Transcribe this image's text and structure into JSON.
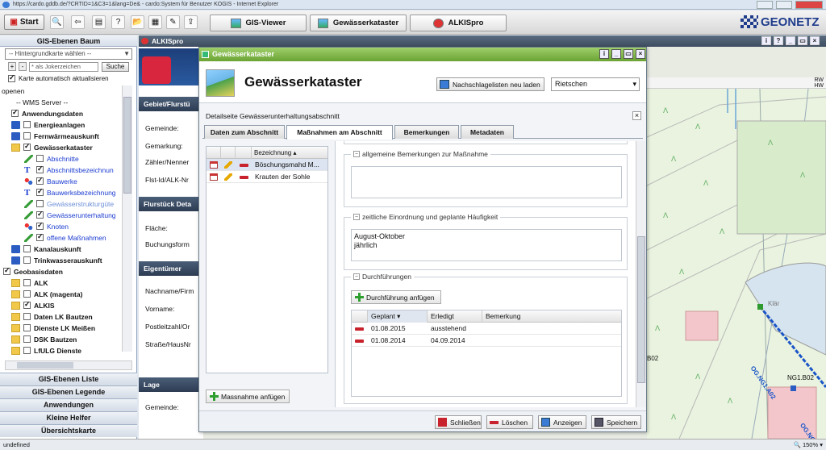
{
  "browser": {
    "url": "https://cardo.gddb.de/?CRTID=1&C3=1&lang=De& - cardo:System für Benutzer KOGIS - Internet Explorer"
  },
  "toolbar": {
    "start": "Start",
    "apps": [
      {
        "label": "GIS-Viewer"
      },
      {
        "label": "Gewässerkataster"
      },
      {
        "label": "ALKISpro"
      }
    ],
    "logo": "GEONETZ"
  },
  "left": {
    "title": "GIS-Ebenen Baum",
    "basemap": "-- Hintergrundkarte wählen --",
    "search_placeholder": "* als Jokerzeichen",
    "search_btn": "Suche",
    "auto": "Karte automatisch aktualisieren",
    "tree": [
      "openen",
      "-- WMS Server --",
      "Anwendungsdaten",
      "Energieanlagen",
      "Fernwärmeauskunft",
      "Gewässerkataster",
      "Abschnitte",
      "Abschnittsbezeichnun",
      "Bauwerke",
      "Bauwerksbezeichnung",
      "Gewässerstrukturgüte",
      "Gewässerunterhaltung",
      "Knoten",
      "offene Maßnahmen",
      "Kanalauskunft",
      "Trinkwasserauskunft",
      "Geobasisdaten",
      "ALK",
      "ALK (magenta)",
      "ALKIS",
      "Daten LK Bautzen",
      "Dienste LK Meißen",
      "DSK Bautzen",
      "LfULG Dienste"
    ],
    "accordion": [
      "GIS-Ebenen Liste",
      "GIS-Ebenen Legende",
      "Anwendungen",
      "Kleine Helfer",
      "Übersichtskarte"
    ]
  },
  "status": {
    "left": "undefined",
    "zoom": "150%"
  },
  "mapwin": {
    "title": "ALKISpro",
    "info1": "RW",
    "info2": "HW",
    "behind": {
      "bar1": "Gebiet/Flurstü",
      "f1": "Gemeinde:",
      "f2": "Gemarkung:",
      "f3": "Zähler/Nenner",
      "f4": "Flst-Id/ALK-Nr",
      "bar2": "Flurstück Deta",
      "f5": "Fläche:",
      "f6": "Buchungsform",
      "bar3": "Eigentümer",
      "f7": "Nachname/Firm",
      "f8": "Vorname:",
      "f9": "Postleitzahl/Or",
      "f10": "Straße/HausNr",
      "bar4": "Lage",
      "f11": "Gemeinde:"
    },
    "labels": {
      "klaer": "Klär",
      "b02": "B02",
      "ng": "NG1.B02",
      "og1": "OG.NG1.A02",
      "og2": "OG.NG"
    }
  },
  "dialog": {
    "title": "Gewässerkataster",
    "heading": "Gewässerkataster",
    "reload": "Nachschlagelisten neu laden",
    "select": "Rietschen",
    "sub": "Detailseite Gewässerunterhaltungsabschnitt",
    "tabs": [
      "Daten zum Abschnitt",
      "Maßnahmen am Abschnitt",
      "Bemerkungen",
      "Metadaten"
    ],
    "list": {
      "header": "Bezeichnung",
      "rows": [
        "Böschungsmahd M...",
        "Krauten der Sohle"
      ]
    },
    "add_measure": "Massnahme anfügen",
    "fs1": "allgemeine Bemerkungen zur Maßnahme",
    "fs2": "zeitliche Einordnung und geplante Häufigkeit",
    "fs2_text1": "August-Oktober",
    "fs2_text2": "jährlich",
    "fs3": "Durchführungen",
    "add_exec": "Durchführung anfügen",
    "grid": {
      "h1": "Geplant",
      "h2": "Erledigt",
      "h3": "Bemerkung",
      "rows": [
        {
          "p": "01.08.2015",
          "e": "ausstehend"
        },
        {
          "p": "01.08.2014",
          "e": "04.09.2014"
        }
      ]
    },
    "footer": {
      "close": "Schließen",
      "delete": "Löschen",
      "show": "Anzeigen",
      "save": "Speichern"
    }
  }
}
